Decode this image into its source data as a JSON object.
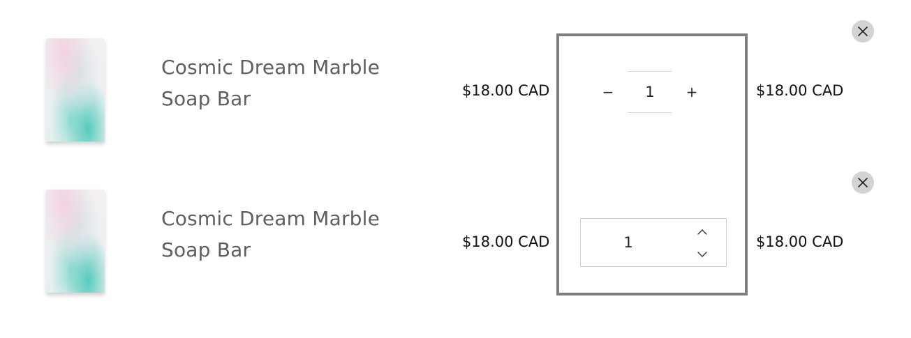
{
  "cart": {
    "items": [
      {
        "title": "Cosmic Dream Marble Soap Bar",
        "unit_price": "$18.00 CAD",
        "quantity": "1",
        "line_total": "$18.00 CAD",
        "quantity_control": "stepper",
        "minus_label": "−",
        "plus_label": "+"
      },
      {
        "title": "Cosmic Dream Marble Soap Bar",
        "unit_price": "$18.00 CAD",
        "quantity": "1",
        "line_total": "$18.00 CAD",
        "quantity_control": "number-input"
      }
    ]
  },
  "icons": {
    "remove": "close-icon",
    "increment": "chevron-up-icon",
    "decrement": "chevron-down-icon"
  },
  "colors": {
    "title_text": "#5f5f5f",
    "price_text": "#111111",
    "remove_button_bg": "#d3d3d3",
    "highlight_border": "#7e7e7e"
  }
}
